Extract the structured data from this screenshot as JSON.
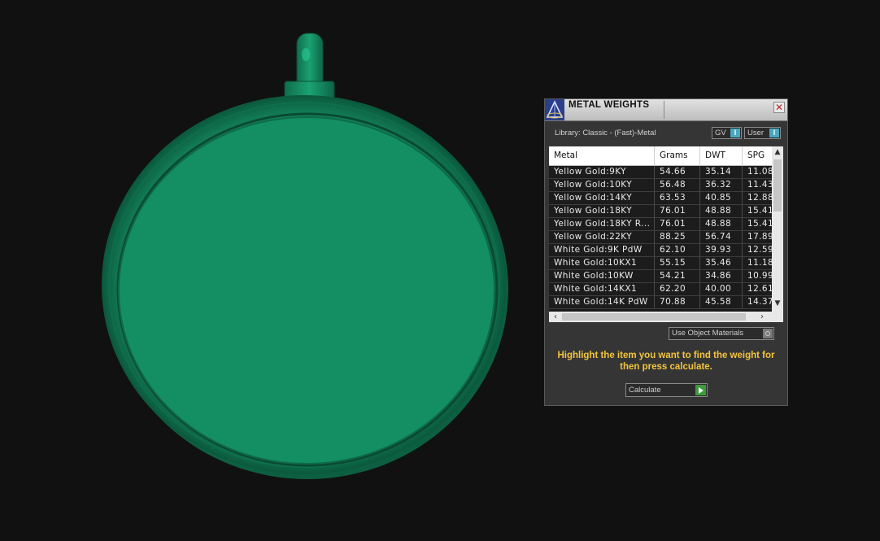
{
  "viewport": {
    "model": "green-pendant-icon",
    "model_color": "#168e65"
  },
  "panel": {
    "title": "METAL WEIGHTS",
    "close_glyph": "✕",
    "library_label": "Library: Classic - (Fast)-Metal",
    "toggles": [
      {
        "label": "GV",
        "knob": "I"
      },
      {
        "label": "User",
        "knob": "I"
      }
    ],
    "table": {
      "columns": [
        "Metal",
        "Grams",
        "DWT",
        "SPG"
      ],
      "rows": [
        [
          "Yellow Gold:9KY",
          "54.66",
          "35.14",
          "11.08"
        ],
        [
          "Yellow Gold:10KY",
          "56.48",
          "36.32",
          "11.43"
        ],
        [
          "Yellow Gold:14KY",
          "63.53",
          "40.85",
          "12.88"
        ],
        [
          "Yellow Gold:18KY",
          "76.01",
          "48.88",
          "15.41"
        ],
        [
          "Yellow Gold:18KY R...",
          "76.01",
          "48.88",
          "15.41"
        ],
        [
          "Yellow Gold:22KY",
          "88.25",
          "56.74",
          "17.89"
        ],
        [
          "White Gold:9K PdW",
          "62.10",
          "39.93",
          "12.59"
        ],
        [
          "White Gold:10KX1",
          "55.15",
          "35.46",
          "11.18"
        ],
        [
          "White Gold:10KW",
          "54.21",
          "34.86",
          "10.99"
        ],
        [
          "White Gold:14KX1",
          "62.20",
          "40.00",
          "12.61"
        ],
        [
          "White Gold:14K PdW",
          "70.88",
          "45.58",
          "14.37"
        ]
      ]
    },
    "use_object_materials": "Use Object Materials",
    "hint": "Highlight the item you want to find the weight for then press calculate.",
    "calculate_label": "Calculate",
    "accent_color": "#f2c53d"
  }
}
